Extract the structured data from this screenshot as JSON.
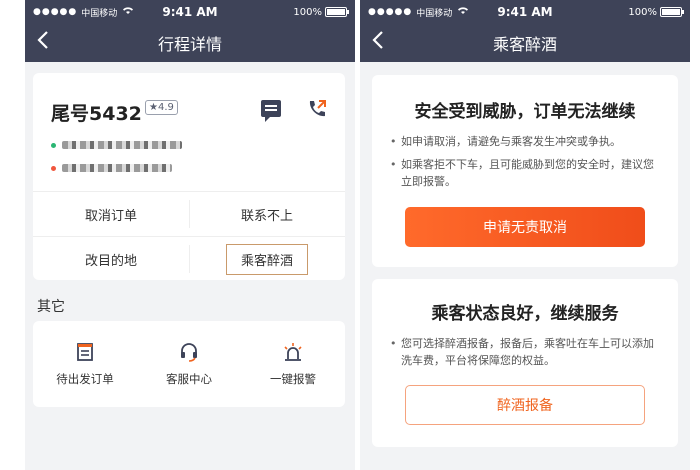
{
  "status_bar": {
    "carrier": "中国移动",
    "time": "9:41 AM",
    "battery": "100%"
  },
  "left": {
    "nav_title": "行程详情",
    "driver": {
      "plate": "尾号5432",
      "rating": "★4.9"
    },
    "actions": {
      "cancel_order": "取消订单",
      "cannot_contact": "联系不上",
      "change_destination": "改目的地",
      "drunk_passenger": "乘客醉酒"
    },
    "other": {
      "title": "其它",
      "items": [
        {
          "label": "待出发订单",
          "icon": "order-list-icon"
        },
        {
          "label": "客服中心",
          "icon": "headset-icon"
        },
        {
          "label": "一键报警",
          "icon": "alarm-light-icon"
        }
      ]
    }
  },
  "right": {
    "nav_title": "乘客醉酒",
    "threat": {
      "title": "安全受到威胁，订单无法继续",
      "bullets": [
        "如申请取消，请避免与乘客发生冲突或争执。",
        "如乘客拒不下车，且可能威胁到您的安全时，建议您立即报警。"
      ],
      "button": "申请无责取消"
    },
    "good": {
      "title": "乘客状态良好，继续服务",
      "bullets": [
        "您可选择醉酒报备，报备后，乘客吐在车上可以添加洗车费，平台将保障您的权益。"
      ],
      "button": "醉酒报备"
    }
  },
  "colors": {
    "header": "#3e4358",
    "accent_orange": "#f0641f",
    "start_dot": "#2bb673",
    "end_dot": "#f0563d",
    "highlight_border": "#c99a6b"
  }
}
